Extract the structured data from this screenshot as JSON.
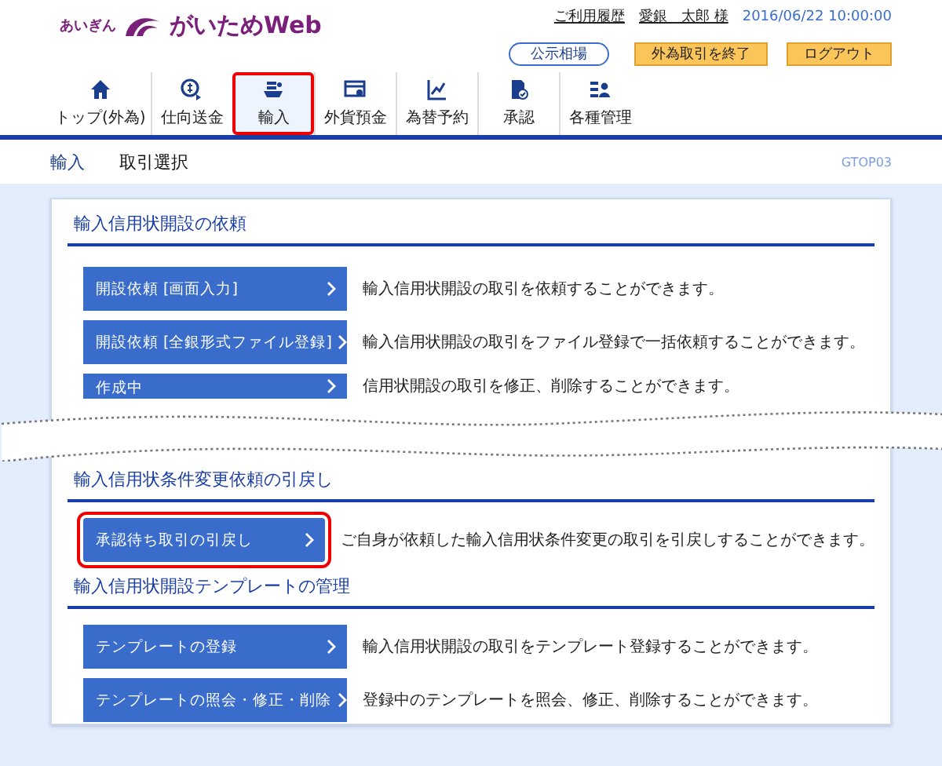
{
  "header": {
    "bank": "あいぎん",
    "product": "がいためWeb",
    "history_link": "ご利用履歴",
    "user": "愛銀　太郎 様",
    "datetime": "2016/06/22 10:00:00"
  },
  "header_buttons": [
    {
      "label": "公示相場",
      "kind": "outline"
    },
    {
      "label": "外為取引を終了",
      "kind": "accent"
    },
    {
      "label": "ログアウト",
      "kind": "accent"
    }
  ],
  "nav": [
    {
      "label": "トップ(外為)",
      "selected": false,
      "highlighted": false
    },
    {
      "label": "仕向送金",
      "selected": false,
      "highlighted": false
    },
    {
      "label": "輸入",
      "selected": true,
      "highlighted": true
    },
    {
      "label": "外貨預金",
      "selected": false,
      "highlighted": false
    },
    {
      "label": "為替予約",
      "selected": false,
      "highlighted": false
    },
    {
      "label": "承認",
      "selected": false,
      "highlighted": false
    },
    {
      "label": "各種管理",
      "selected": false,
      "highlighted": false
    }
  ],
  "breadcrumb": {
    "section": "輸入",
    "page": "取引選択",
    "screen_id": "GTOP03"
  },
  "sections": [
    {
      "title": "輸入信用状開設の依頼",
      "items": [
        {
          "label": "開設依頼 [画面入力]",
          "description": "輸入信用状開設の取引を依頼することができます。",
          "highlighted": false,
          "cut": false
        },
        {
          "label": "開設依頼 [全銀形式ファイル登録]",
          "description": "輸入信用状開設の取引をファイル登録で一括依頼することができます。",
          "highlighted": false,
          "cut": false
        },
        {
          "label": "作成中",
          "description": "信用状開設の取引を修正、削除することができます。",
          "highlighted": false,
          "cut": true
        }
      ]
    },
    {
      "title": "輸入信用状条件変更依頼の引戻し",
      "items": [
        {
          "label": "承認待ち取引の引戻し",
          "description": "ご自身が依頼した輸入信用状条件変更の取引を引戻しすることができます。",
          "highlighted": true,
          "cut": false
        }
      ]
    },
    {
      "title": "輸入信用状開設テンプレートの管理",
      "items": [
        {
          "label": "テンプレートの登録",
          "description": "輸入信用状開設の取引をテンプレート登録することができます。",
          "highlighted": false,
          "cut": false
        },
        {
          "label": "テンプレートの照会・修正・削除",
          "description": "登録中のテンプレートを照会、修正、削除することができます。",
          "highlighted": false,
          "cut": false
        }
      ]
    }
  ]
}
